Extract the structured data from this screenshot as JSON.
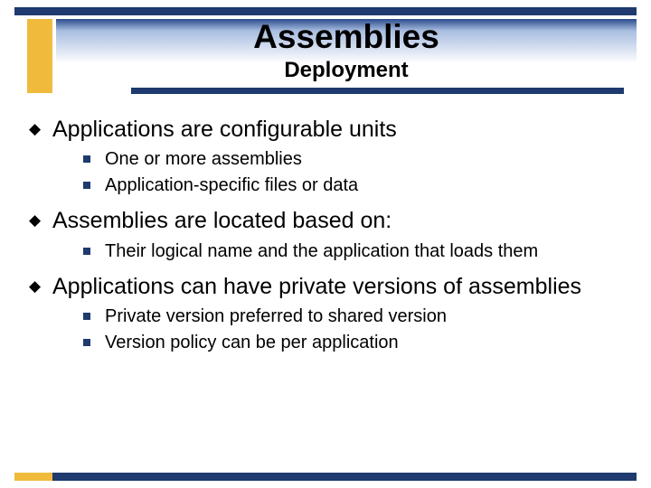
{
  "title": "Assemblies",
  "subtitle": "Deployment",
  "bullets": [
    {
      "text": "Applications are configurable units",
      "sub": [
        "One or more assemblies",
        "Application-specific files or data"
      ]
    },
    {
      "text": "Assemblies are located based on:",
      "sub": [
        "Their logical name and the application that loads them"
      ]
    },
    {
      "text": "Applications can have private versions of assemblies",
      "sub": [
        "Private version preferred to shared version",
        "Version policy can be per application"
      ]
    }
  ]
}
